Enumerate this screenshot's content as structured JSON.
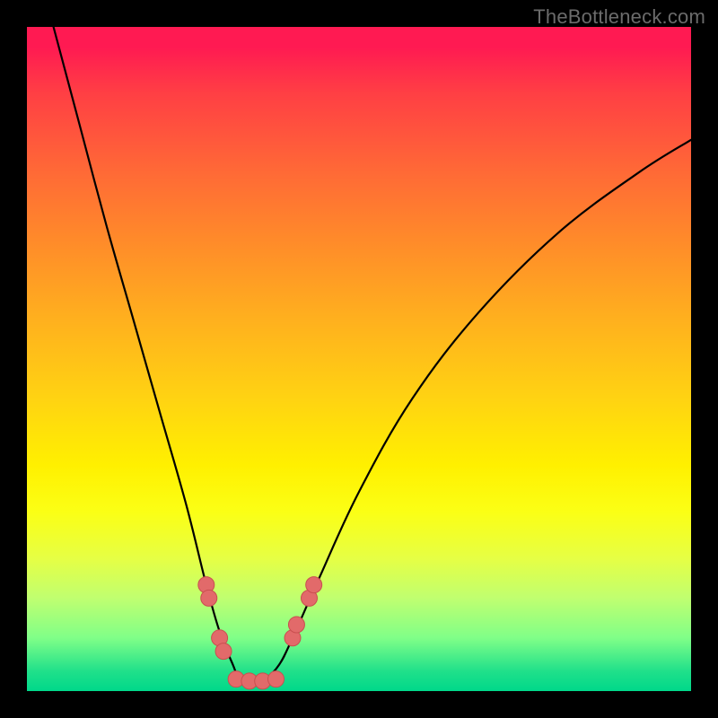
{
  "watermark": "TheBottleneck.com",
  "chart_data": {
    "type": "line",
    "title": "",
    "xlabel": "",
    "ylabel": "",
    "xlim": [
      0,
      100
    ],
    "ylim": [
      0,
      100
    ],
    "series": [
      {
        "name": "bottleneck-curve",
        "x": [
          4,
          8,
          12,
          16,
          20,
          24,
          27,
          29,
          31,
          32,
          34,
          36,
          38,
          40,
          44,
          50,
          58,
          68,
          80,
          92,
          100
        ],
        "y": [
          100,
          85,
          70,
          56,
          42,
          28,
          16,
          9,
          4,
          2,
          2,
          2,
          4,
          8,
          17,
          30,
          44,
          57,
          69,
          78,
          83
        ]
      }
    ],
    "markers": [
      {
        "name": "marker-left-upper-a",
        "x": 27.0,
        "y": 16
      },
      {
        "name": "marker-left-upper-b",
        "x": 27.4,
        "y": 14
      },
      {
        "name": "marker-left-lower-a",
        "x": 29.0,
        "y": 8
      },
      {
        "name": "marker-left-lower-b",
        "x": 29.6,
        "y": 6
      },
      {
        "name": "marker-bottom-1",
        "x": 31.5,
        "y": 1.8
      },
      {
        "name": "marker-bottom-2",
        "x": 33.5,
        "y": 1.5
      },
      {
        "name": "marker-bottom-3",
        "x": 35.5,
        "y": 1.5
      },
      {
        "name": "marker-bottom-4",
        "x": 37.5,
        "y": 1.8
      },
      {
        "name": "marker-right-lower-a",
        "x": 40.0,
        "y": 8
      },
      {
        "name": "marker-right-lower-b",
        "x": 40.6,
        "y": 10
      },
      {
        "name": "marker-right-upper-a",
        "x": 42.5,
        "y": 14
      },
      {
        "name": "marker-right-upper-b",
        "x": 43.2,
        "y": 16
      }
    ],
    "colors": {
      "curve": "#000000",
      "marker_fill": "#e26a6a",
      "marker_stroke": "#c94f4f"
    }
  }
}
